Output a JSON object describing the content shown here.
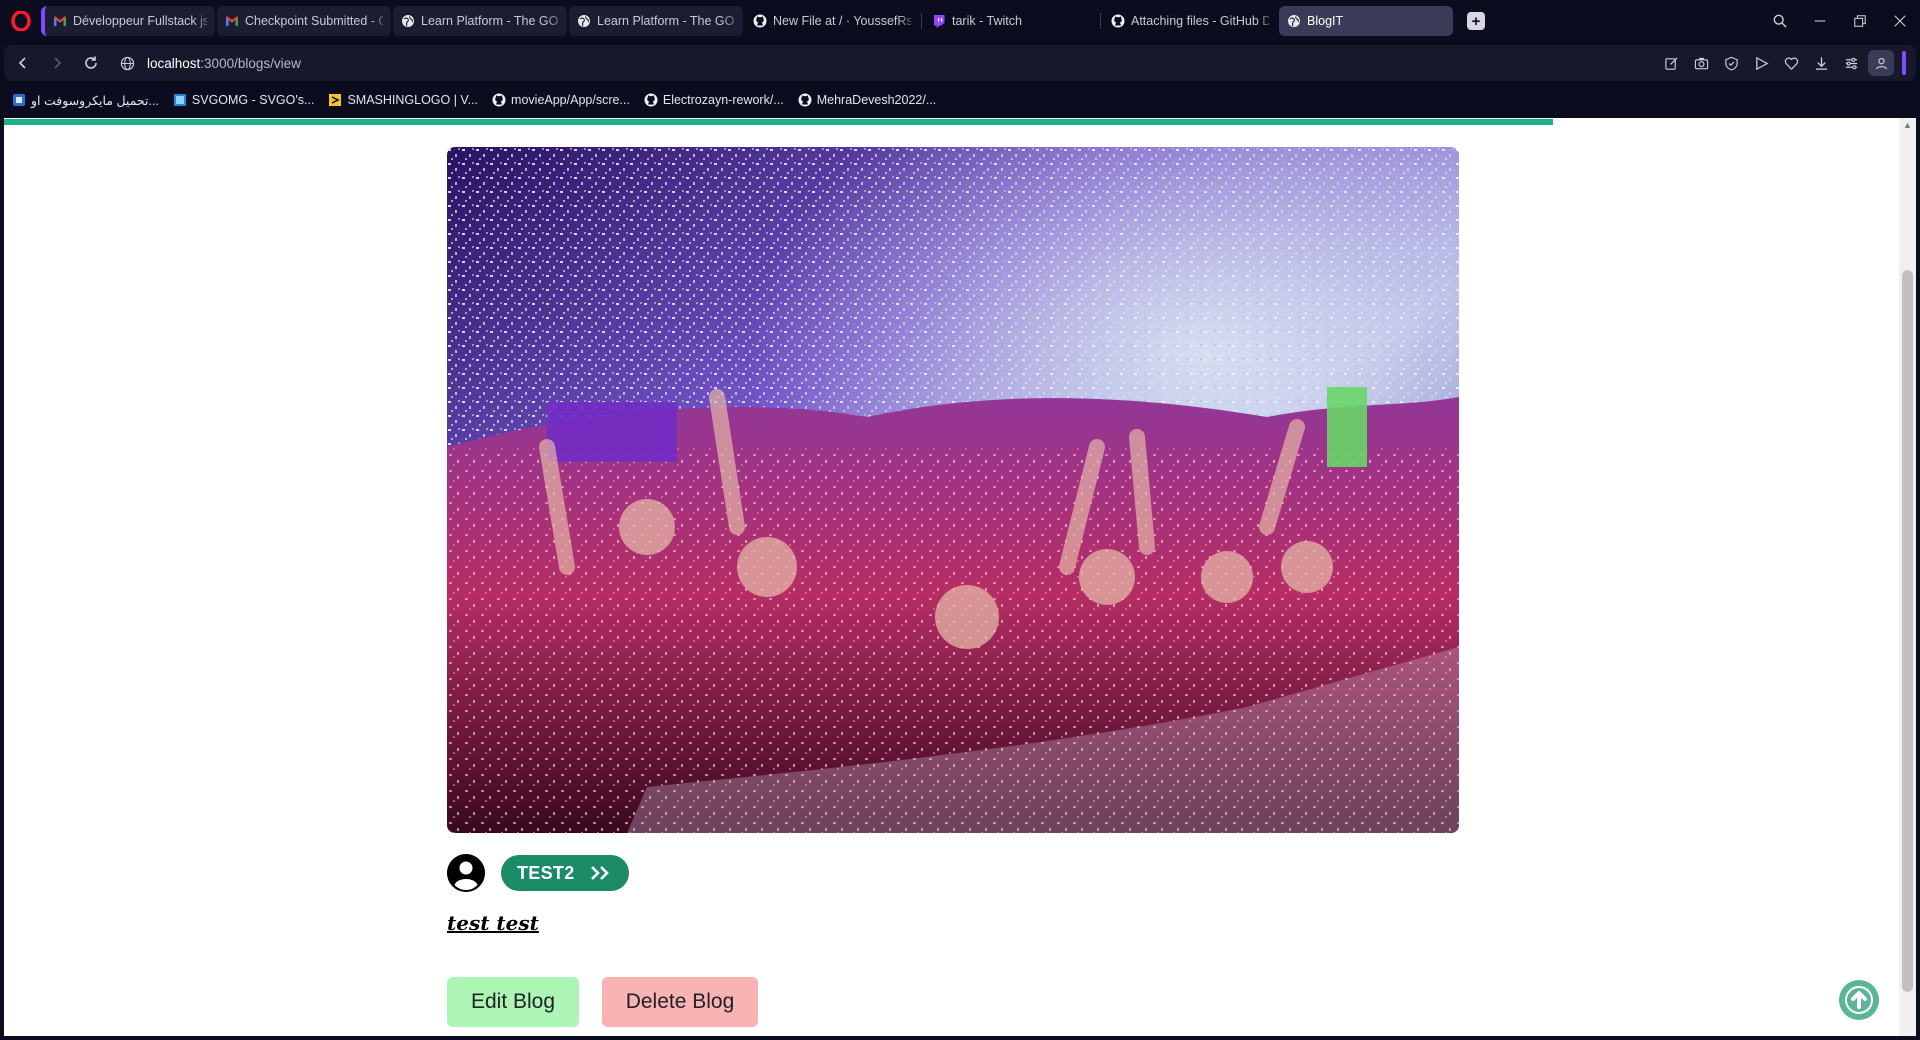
{
  "browser": {
    "tabs": [
      {
        "title": "Développeur Fullstack js",
        "icon": "gmail-icon",
        "group": true,
        "group_first": true
      },
      {
        "title": "Checkpoint Submitted - Gmail",
        "icon": "gmail-icon",
        "group": true
      },
      {
        "title": "Learn Platform - The GOMYCODE",
        "icon": "globe-icon",
        "group": true
      },
      {
        "title": "Learn Platform - The GOMYCODE",
        "icon": "globe-icon",
        "group": true
      },
      {
        "title": "New File at / · YoussefRs/Blog",
        "icon": "github-icon",
        "group": false
      },
      {
        "title": "tarik - Twitch",
        "icon": "twitch-icon",
        "group": false
      },
      {
        "title": "Attaching files - GitHub Docs",
        "icon": "github-icon",
        "group": false
      },
      {
        "title": "BlogIT",
        "icon": "globe-icon",
        "group": false,
        "active": true
      }
    ],
    "address": {
      "host": "localhost",
      "path": ":3000/blogs/view"
    },
    "bookmarks": [
      {
        "label": "تحميل مايكروسوفت او...",
        "icon": "office-icon",
        "color": "#2b6fd6"
      },
      {
        "label": "SVGOMG - SVGO's...",
        "icon": "svgomg-icon",
        "color": "#1e88e5"
      },
      {
        "label": "SMASHINGLOGO | V...",
        "icon": "smashinglogo-icon",
        "color": "#f2c230"
      },
      {
        "label": "movieApp/App/scre...",
        "icon": "github-icon",
        "color": "#ffffff"
      },
      {
        "label": "Electrozayn-rework/...",
        "icon": "github-icon",
        "color": "#ffffff"
      },
      {
        "label": "MehraDevesh2022/...",
        "icon": "github-icon",
        "color": "#ffffff"
      }
    ]
  },
  "page": {
    "progress_percent": 81,
    "tag_label": "TEST2",
    "blog_title": "test test",
    "edit_label": "Edit Blog",
    "delete_label": "Delete Blog"
  },
  "colors": {
    "accent_green": "#1b8a66",
    "progress": "#1bb286",
    "edit_bg": "#adf5b4",
    "delete_bg": "#f8b3b2",
    "browser_accent": "#7b4dff"
  }
}
